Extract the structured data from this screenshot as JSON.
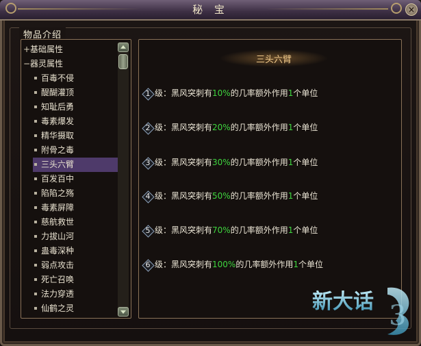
{
  "window": {
    "title": "秘 宝",
    "close_label": "×"
  },
  "section": {
    "label": "物品介绍"
  },
  "tree": {
    "groups": [
      {
        "label": "基础属性",
        "toggle": "+"
      },
      {
        "label": "器灵属性",
        "toggle": "−"
      }
    ],
    "items": [
      "百毒不侵",
      "醍醐灌顶",
      "知耻后勇",
      "毒素爆发",
      "精华摄取",
      "附骨之毒",
      "三头六臂",
      "百发百中",
      "陷陷之殇",
      "毒素屏障",
      "慈航救世",
      "力拔山河",
      "蛊毒深种",
      "弱点攻击",
      "死亡召唤",
      "法力穿透",
      "仙鹤之灵"
    ],
    "selected_index": 6
  },
  "detail": {
    "title": "三头六臂",
    "levels": [
      {
        "num": "1",
        "prefix": "级：黑风突刺有",
        "percent": "10%",
        "mid": "的几率额外作用",
        "count": "1",
        "suffix": "个单位"
      },
      {
        "num": "2",
        "prefix": "级：黑风突刺有",
        "percent": "20%",
        "mid": "的几率额外作用",
        "count": "1",
        "suffix": "个单位"
      },
      {
        "num": "3",
        "prefix": "级：黑风突刺有",
        "percent": "30%",
        "mid": "的几率额外作用",
        "count": "1",
        "suffix": "个单位"
      },
      {
        "num": "4",
        "prefix": "级：黑风突刺有",
        "percent": "50%",
        "mid": "的几率额外作用",
        "count": "1",
        "suffix": "个单位"
      },
      {
        "num": "5",
        "prefix": "级：黑风突刺有",
        "percent": "70%",
        "mid": "的几率额外作用",
        "count": "1",
        "suffix": "个单位"
      },
      {
        "num": "6",
        "prefix": "级：黑风突刺有",
        "percent": "100%",
        "mid": "的几率额外作用",
        "count": "1",
        "suffix": "个单位"
      }
    ]
  },
  "logo": {
    "text": "新大话",
    "digit": "3"
  },
  "colors": {
    "highlight": "#3fd63f",
    "selected_bg": "#4e3a6a",
    "title_gold": "#f1c98a"
  }
}
